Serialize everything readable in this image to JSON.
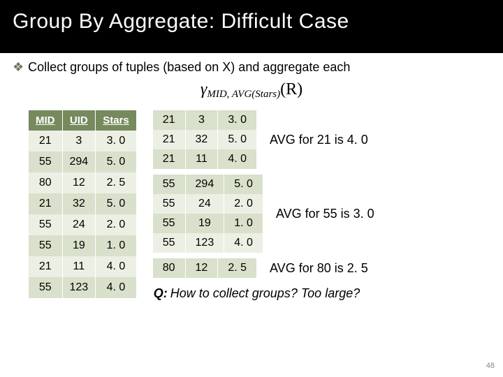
{
  "header": {
    "title": "Group By Aggregate: Difficult Case"
  },
  "bullet": {
    "text": "Collect groups of tuples (based on X) and aggregate each"
  },
  "formula": {
    "gamma": "γ",
    "sub": "MID, AVG(Stars)",
    "r": "(R)"
  },
  "leftTable": {
    "headers": [
      "MID",
      "UID",
      "Stars"
    ],
    "rows": [
      [
        "21",
        "3",
        "3. 0"
      ],
      [
        "55",
        "294",
        "5. 0"
      ],
      [
        "80",
        "12",
        "2. 5"
      ],
      [
        "21",
        "32",
        "5. 0"
      ],
      [
        "55",
        "24",
        "2. 0"
      ],
      [
        "55",
        "19",
        "1. 0"
      ],
      [
        "21",
        "11",
        "4. 0"
      ],
      [
        "55",
        "123",
        "4. 0"
      ]
    ]
  },
  "groups": [
    {
      "rows": [
        [
          "21",
          "3",
          "3. 0"
        ],
        [
          "21",
          "32",
          "5. 0"
        ],
        [
          "21",
          "11",
          "4. 0"
        ]
      ],
      "avg": "AVG for 21 is 4. 0"
    },
    {
      "rows": [
        [
          "55",
          "294",
          "5. 0"
        ],
        [
          "55",
          "24",
          "2. 0"
        ],
        [
          "55",
          "19",
          "1. 0"
        ],
        [
          "55",
          "123",
          "4. 0"
        ]
      ],
      "avg": "AVG for 55 is 3. 0"
    },
    {
      "rows": [
        [
          "80",
          "12",
          "2. 5"
        ]
      ],
      "avg": "AVG for 80 is 2. 5"
    }
  ],
  "question": {
    "prefix": "Q:",
    "text": "How to collect groups? Too large?"
  },
  "slideNum": "48"
}
